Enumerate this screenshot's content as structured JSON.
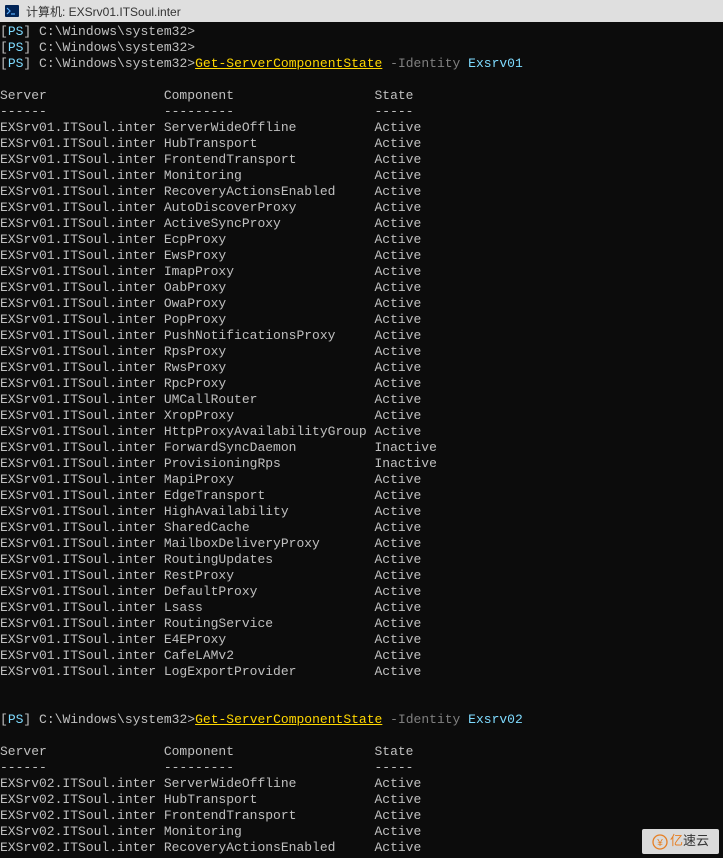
{
  "window": {
    "title": "计算机: EXSrv01.ITSoul.inter"
  },
  "prompt": {
    "ps": "PS",
    "path": "C:\\Windows\\system32",
    "gt": ">"
  },
  "commands": [
    {
      "cmdlet": "Get-ServerComponentState",
      "param": "-Identity",
      "arg": "Exsrv01"
    },
    {
      "cmdlet": "Get-ServerComponentState",
      "param": "-Identity",
      "arg": "Exsrv02"
    }
  ],
  "headers": {
    "col1": "Server",
    "col2": "Component",
    "col3": "State"
  },
  "separators": {
    "col1": "------",
    "col2": "---------",
    "col3": "-----"
  },
  "colWidths": {
    "col1": 21,
    "col2": 27,
    "col3": 10
  },
  "results1": [
    {
      "server": "EXSrv01.ITSoul.inter",
      "component": "ServerWideOffline",
      "state": "Active"
    },
    {
      "server": "EXSrv01.ITSoul.inter",
      "component": "HubTransport",
      "state": "Active"
    },
    {
      "server": "EXSrv01.ITSoul.inter",
      "component": "FrontendTransport",
      "state": "Active"
    },
    {
      "server": "EXSrv01.ITSoul.inter",
      "component": "Monitoring",
      "state": "Active"
    },
    {
      "server": "EXSrv01.ITSoul.inter",
      "component": "RecoveryActionsEnabled",
      "state": "Active"
    },
    {
      "server": "EXSrv01.ITSoul.inter",
      "component": "AutoDiscoverProxy",
      "state": "Active"
    },
    {
      "server": "EXSrv01.ITSoul.inter",
      "component": "ActiveSyncProxy",
      "state": "Active"
    },
    {
      "server": "EXSrv01.ITSoul.inter",
      "component": "EcpProxy",
      "state": "Active"
    },
    {
      "server": "EXSrv01.ITSoul.inter",
      "component": "EwsProxy",
      "state": "Active"
    },
    {
      "server": "EXSrv01.ITSoul.inter",
      "component": "ImapProxy",
      "state": "Active"
    },
    {
      "server": "EXSrv01.ITSoul.inter",
      "component": "OabProxy",
      "state": "Active"
    },
    {
      "server": "EXSrv01.ITSoul.inter",
      "component": "OwaProxy",
      "state": "Active"
    },
    {
      "server": "EXSrv01.ITSoul.inter",
      "component": "PopProxy",
      "state": "Active"
    },
    {
      "server": "EXSrv01.ITSoul.inter",
      "component": "PushNotificationsProxy",
      "state": "Active"
    },
    {
      "server": "EXSrv01.ITSoul.inter",
      "component": "RpsProxy",
      "state": "Active"
    },
    {
      "server": "EXSrv01.ITSoul.inter",
      "component": "RwsProxy",
      "state": "Active"
    },
    {
      "server": "EXSrv01.ITSoul.inter",
      "component": "RpcProxy",
      "state": "Active"
    },
    {
      "server": "EXSrv01.ITSoul.inter",
      "component": "UMCallRouter",
      "state": "Active"
    },
    {
      "server": "EXSrv01.ITSoul.inter",
      "component": "XropProxy",
      "state": "Active"
    },
    {
      "server": "EXSrv01.ITSoul.inter",
      "component": "HttpProxyAvailabilityGroup",
      "state": "Active"
    },
    {
      "server": "EXSrv01.ITSoul.inter",
      "component": "ForwardSyncDaemon",
      "state": "Inactive"
    },
    {
      "server": "EXSrv01.ITSoul.inter",
      "component": "ProvisioningRps",
      "state": "Inactive"
    },
    {
      "server": "EXSrv01.ITSoul.inter",
      "component": "MapiProxy",
      "state": "Active"
    },
    {
      "server": "EXSrv01.ITSoul.inter",
      "component": "EdgeTransport",
      "state": "Active"
    },
    {
      "server": "EXSrv01.ITSoul.inter",
      "component": "HighAvailability",
      "state": "Active"
    },
    {
      "server": "EXSrv01.ITSoul.inter",
      "component": "SharedCache",
      "state": "Active"
    },
    {
      "server": "EXSrv01.ITSoul.inter",
      "component": "MailboxDeliveryProxy",
      "state": "Active"
    },
    {
      "server": "EXSrv01.ITSoul.inter",
      "component": "RoutingUpdates",
      "state": "Active"
    },
    {
      "server": "EXSrv01.ITSoul.inter",
      "component": "RestProxy",
      "state": "Active"
    },
    {
      "server": "EXSrv01.ITSoul.inter",
      "component": "DefaultProxy",
      "state": "Active"
    },
    {
      "server": "EXSrv01.ITSoul.inter",
      "component": "Lsass",
      "state": "Active"
    },
    {
      "server": "EXSrv01.ITSoul.inter",
      "component": "RoutingService",
      "state": "Active"
    },
    {
      "server": "EXSrv01.ITSoul.inter",
      "component": "E4EProxy",
      "state": "Active"
    },
    {
      "server": "EXSrv01.ITSoul.inter",
      "component": "CafeLAMv2",
      "state": "Active"
    },
    {
      "server": "EXSrv01.ITSoul.inter",
      "component": "LogExportProvider",
      "state": "Active"
    }
  ],
  "results2": [
    {
      "server": "EXSrv02.ITSoul.inter",
      "component": "ServerWideOffline",
      "state": "Active"
    },
    {
      "server": "EXSrv02.ITSoul.inter",
      "component": "HubTransport",
      "state": "Active"
    },
    {
      "server": "EXSrv02.ITSoul.inter",
      "component": "FrontendTransport",
      "state": "Active"
    },
    {
      "server": "EXSrv02.ITSoul.inter",
      "component": "Monitoring",
      "state": "Active"
    },
    {
      "server": "EXSrv02.ITSoul.inter",
      "component": "RecoveryActionsEnabled",
      "state": "Active"
    }
  ],
  "watermark": {
    "part1": "亿",
    "part2": "速云"
  }
}
